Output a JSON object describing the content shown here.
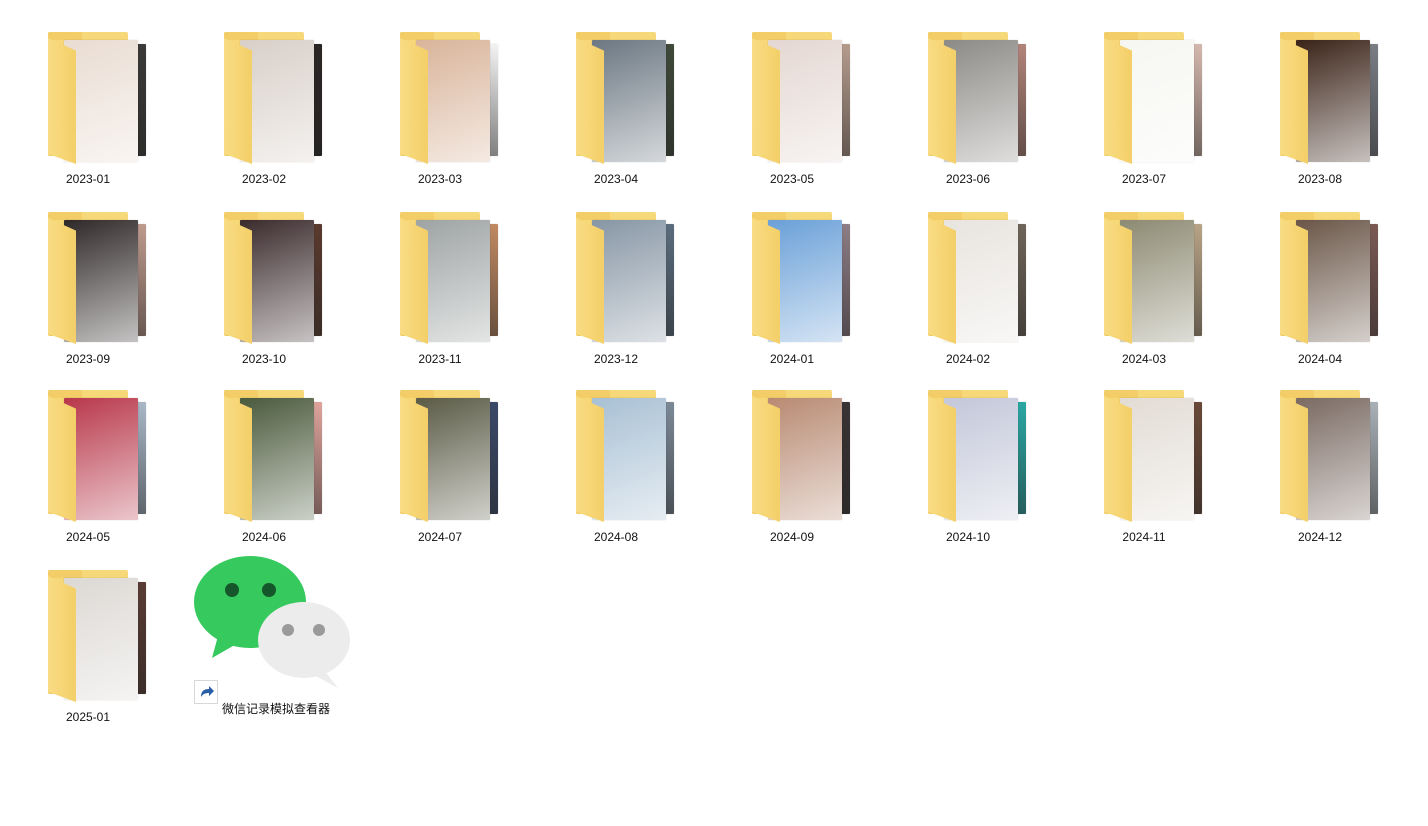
{
  "folders": [
    {
      "label": "2023-01",
      "c1": "#e9dcd2",
      "c2": "#3b3a38"
    },
    {
      "label": "2023-02",
      "c1": "#d8cfc8",
      "c2": "#2b2624"
    },
    {
      "label": "2023-03",
      "c1": "#d9b49a",
      "c2": "#f4f4f4"
    },
    {
      "label": "2023-04",
      "c1": "#6b7782",
      "c2": "#3f4a3a"
    },
    {
      "label": "2023-05",
      "c1": "#e4d7d2",
      "c2": "#b59c8d"
    },
    {
      "label": "2023-06",
      "c1": "#8c8a86",
      "c2": "#b3857a"
    },
    {
      "label": "2023-07",
      "c1": "#f6f6f2",
      "c2": "#d6b9ae"
    },
    {
      "label": "2023-08",
      "c1": "#3a2318",
      "c2": "#7b7f86"
    },
    {
      "label": "2023-09",
      "c1": "#2f2828",
      "c2": "#bf9b8e"
    },
    {
      "label": "2023-10",
      "c1": "#3a2a2c",
      "c2": "#5a3a2e"
    },
    {
      "label": "2023-11",
      "c1": "#9ea3a3",
      "c2": "#c28a62"
    },
    {
      "label": "2023-12",
      "c1": "#8796a5",
      "c2": "#5b6d7e"
    },
    {
      "label": "2024-01",
      "c1": "#6aa0d8",
      "c2": "#8e7d86"
    },
    {
      "label": "2024-02",
      "c1": "#e8e4df",
      "c2": "#6f655a"
    },
    {
      "label": "2024-03",
      "c1": "#8d8a72",
      "c2": "#b9a486"
    },
    {
      "label": "2024-04",
      "c1": "#6a5648",
      "c2": "#7c5a54"
    },
    {
      "label": "2024-05",
      "c1": "#b8374a",
      "c2": "#aab8c8"
    },
    {
      "label": "2024-06",
      "c1": "#4a5a3c",
      "c2": "#dfa49c"
    },
    {
      "label": "2024-07",
      "c1": "#5a5a46",
      "c2": "#3b4a6a"
    },
    {
      "label": "2024-08",
      "c1": "#a8c0d4",
      "c2": "#7c8a98"
    },
    {
      "label": "2024-09",
      "c1": "#b88a72",
      "c2": "#3a3434"
    },
    {
      "label": "2024-10",
      "c1": "#c3c7d9",
      "c2": "#2aa8a4"
    },
    {
      "label": "2024-11",
      "c1": "#e2dcd4",
      "c2": "#6a4a38"
    },
    {
      "label": "2024-12",
      "c1": "#7a6a62",
      "c2": "#aab2b8"
    },
    {
      "label": "2025-01",
      "c1": "#dcd8d4",
      "c2": "#5a3c34"
    }
  ],
  "shortcut": {
    "label": "微信记录模拟查看器",
    "icon": "wechat-icon",
    "green": "#2ecb5a",
    "gray": "#e8e8e8"
  }
}
